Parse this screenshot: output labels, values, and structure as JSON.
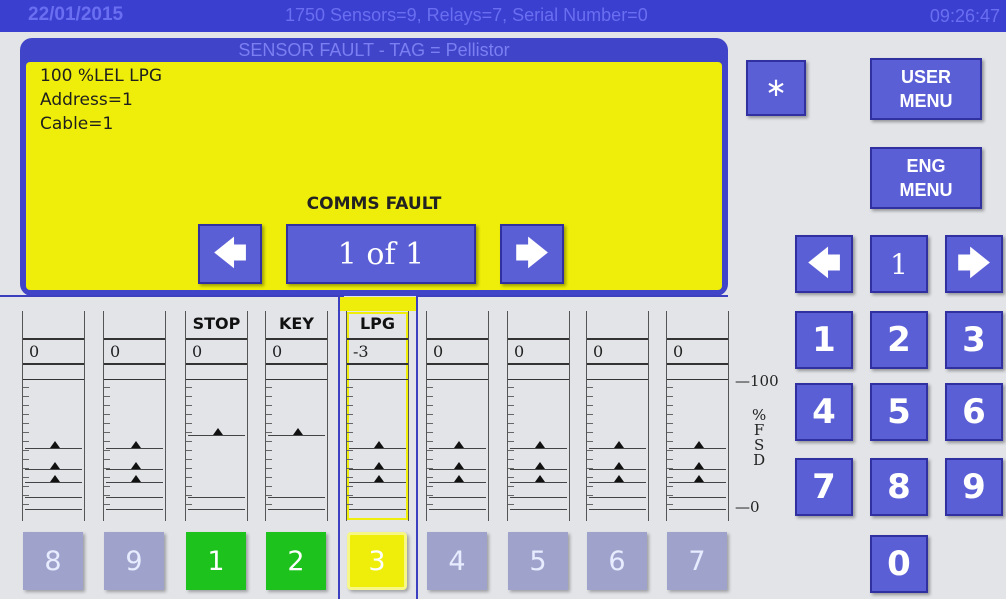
{
  "status_bar": {
    "date": "22/01/2015",
    "system_info": "1750  Sensors=9, Relays=7, Serial Number=0",
    "time": "09:26:47"
  },
  "fault_panel": {
    "title": "SENSOR FAULT - TAG = Pellistor",
    "sensor_line": "100 %LEL LPG",
    "address": "Address=1",
    "cable": "Cable=1",
    "message": "COMMS FAULT",
    "pager": "1 of 1"
  },
  "menus": {
    "user_menu": "USER\nMENU",
    "eng_menu": "ENG\nMENU",
    "user_line1": "USER",
    "user_line2": "MENU",
    "eng_line1": "ENG",
    "eng_line2": "MENU"
  },
  "keypad": {
    "nav_value": "1",
    "keys": [
      "1",
      "2",
      "3",
      "4",
      "5",
      "6",
      "7",
      "8",
      "9",
      "0"
    ]
  },
  "channels": [
    {
      "label": "",
      "value": "0",
      "button": "8",
      "state": "normal"
    },
    {
      "label": "",
      "value": "0",
      "button": "9",
      "state": "normal"
    },
    {
      "label": "STOP",
      "value": "0",
      "button": "1",
      "state": "green"
    },
    {
      "label": "KEY",
      "value": "0",
      "button": "2",
      "state": "green"
    },
    {
      "label": "LPG",
      "value": "-3",
      "button": "3",
      "state": "selected"
    },
    {
      "label": "",
      "value": "0",
      "button": "4",
      "state": "normal"
    },
    {
      "label": "",
      "value": "0",
      "button": "5",
      "state": "normal"
    },
    {
      "label": "",
      "value": "0",
      "button": "6",
      "state": "normal"
    },
    {
      "label": "",
      "value": "0",
      "button": "7",
      "state": "normal"
    }
  ],
  "scale": {
    "top": "—100",
    "bottom": "—0",
    "unit_chars": [
      "%",
      "F",
      "S",
      "D"
    ]
  },
  "icons": {
    "bluetooth": "bluetooth-icon",
    "left": "arrow-left-icon",
    "right": "arrow-right-icon"
  },
  "colors": {
    "accent_blue": "#3b3fd0",
    "fault_yellow": "#eeee0a",
    "active_green": "#1dc21d"
  }
}
